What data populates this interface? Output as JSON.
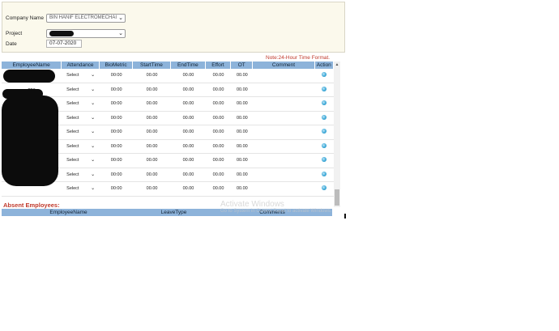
{
  "form": {
    "company_label": "Company Name",
    "company_value": "BIN HANIF ELECTROMECHAI",
    "project_label": "Project",
    "date_label": "Date",
    "date_value": "07-07-2020"
  },
  "note": "Note:24-Hour Time Format.",
  "table": {
    "headers": [
      "EmployeeName",
      "Attendance",
      "BioMetric",
      "StartTime",
      "EndTime",
      "Effort",
      "OT",
      "Comment",
      "Action"
    ],
    "rows": [
      {
        "name": "",
        "attendance": "Select",
        "biometric": "00:00",
        "start": "00.00",
        "end": "00.00",
        "effort": "00.00",
        "ot": "00.00"
      },
      {
        "name": "ppa",
        "attendance": "Select",
        "biometric": "00:00",
        "start": "00.00",
        "end": "00.00",
        "effort": "00.00",
        "ot": "00.00"
      },
      {
        "name": "",
        "attendance": "Select",
        "biometric": "00:00",
        "start": "00.00",
        "end": "00.00",
        "effort": "00.00",
        "ot": "00.00"
      },
      {
        "name": "",
        "attendance": "Select",
        "biometric": "00:00",
        "start": "00.00",
        "end": "00.00",
        "effort": "00.00",
        "ot": "00.00"
      },
      {
        "name": "",
        "attendance": "Select",
        "biometric": "00:00",
        "start": "00.00",
        "end": "00.00",
        "effort": "00.00",
        "ot": "00.00"
      },
      {
        "name": "",
        "attendance": "Select",
        "biometric": "00:00",
        "start": "00.00",
        "end": "00.00",
        "effort": "00.00",
        "ot": "00.00"
      },
      {
        "name": "",
        "attendance": "Select",
        "biometric": "00:00",
        "start": "00.00",
        "end": "00.00",
        "effort": "00.00",
        "ot": "00.00"
      },
      {
        "name": "",
        "attendance": "Select",
        "biometric": "00:00",
        "start": "00.00",
        "end": "00.00",
        "effort": "00.00",
        "ot": "00.00"
      },
      {
        "name": "",
        "attendance": "Select",
        "biometric": "00:00",
        "start": "00.00",
        "end": "00.00",
        "effort": "00.00",
        "ot": "00.00"
      }
    ]
  },
  "absent": {
    "title": "Absent Employees:",
    "headers": [
      "EmployeeName",
      "LeaveType",
      "Comments"
    ]
  },
  "watermark": {
    "title": "Activate Windows",
    "subtitle": "Go to System in Control Panel to activate Windows."
  },
  "icons": {
    "dropdown": "chevron-down-icon",
    "action": "globe-icon"
  },
  "colors": {
    "header_bg": "#8db3da",
    "note": "#c0392b",
    "panel_bg": "#fbf9ec"
  }
}
